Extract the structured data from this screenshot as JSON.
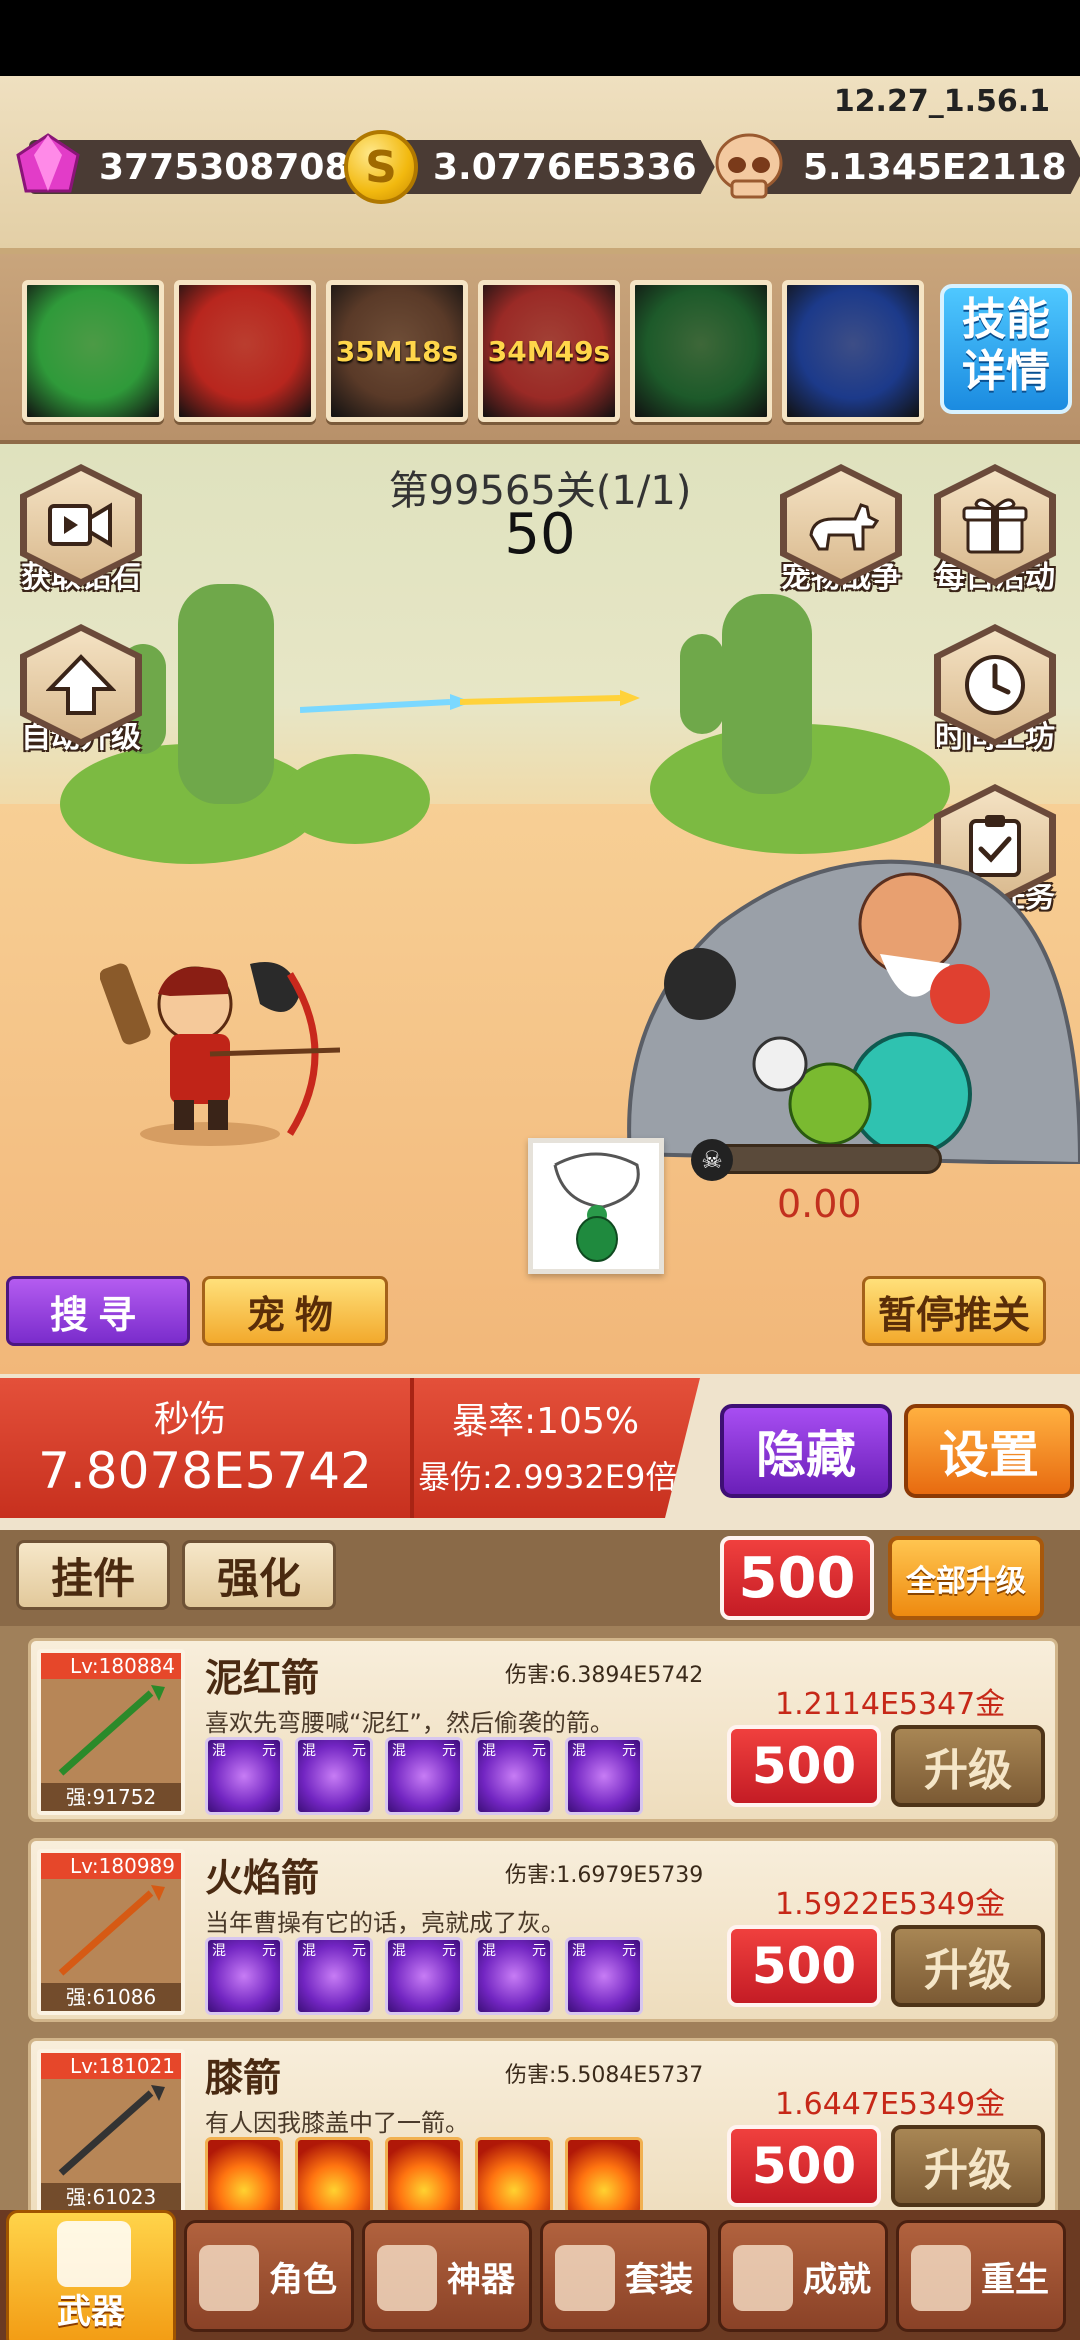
{
  "version": "12.27_1.56.1",
  "currencies": {
    "gems": "37753087084",
    "gold": "3.0776E5336",
    "souls": "5.1345E2118"
  },
  "coin_symbol": "S",
  "skills": [
    {
      "name": "green-arrows-skill-icon",
      "cooldown": "",
      "color": "#2f9a3a"
    },
    {
      "name": "red-slash-skill-icon",
      "cooldown": "",
      "color": "#b8261e"
    },
    {
      "name": "gold-burst-skill-icon",
      "cooldown": "35M18s",
      "color": "#5a3a28"
    },
    {
      "name": "red-aura-skill-icon",
      "cooldown": "34M49s",
      "color": "#9a2a26"
    },
    {
      "name": "bow-skill-icon",
      "cooldown": "",
      "color": "#1d5a2a"
    },
    {
      "name": "clock-skill-icon",
      "cooldown": "",
      "color": "#1c3a8a"
    }
  ],
  "skill_detail_label": "技能\n详情",
  "stage": {
    "label": "第99565关(1/1)",
    "count": "50"
  },
  "side_buttons": {
    "get_gems": "获取钻石",
    "auto_upgrade": "自动升级",
    "pet_war": "宠物战争",
    "daily_event": "每日活动",
    "time_workshop": "时间工坊",
    "daily_task": "日常任务"
  },
  "enemy_hp": "0.00",
  "enemy_hp_fraction": 0,
  "scene_buttons": {
    "search": "搜寻",
    "pet": "宠物",
    "pause": "暂停推关"
  },
  "dps": {
    "label": "秒伤",
    "value": "7.8078E5742",
    "crit_rate": "暴率:105%",
    "crit_damage": "暴伤:2.9932E9倍"
  },
  "buttons": {
    "hide": "隐藏",
    "settings": "设置"
  },
  "tabs": {
    "equip": "挂件",
    "enhance": "强化"
  },
  "bulk_qty": "500",
  "upgrade_all": "全部升级",
  "weapons": [
    {
      "level": "Lv:180884",
      "strength": "强:91752",
      "name": "泥红箭",
      "damage": "伤害:6.3894E5742",
      "desc": "喜欢先弯腰喊“泥红”，然后偷袭的箭。",
      "price": "1.2114E5347金",
      "qty": "500",
      "upgrade": "升级",
      "gem_type": "yinyang",
      "gem_tags": [
        "混",
        "元"
      ],
      "arrow_color": "#2b8a2a"
    },
    {
      "level": "Lv:180989",
      "strength": "强:61086",
      "name": "火焰箭",
      "damage": "伤害:1.6979E5739",
      "desc": "当年曹操有它的话，亮就成了灰。",
      "price": "1.5922E5349金",
      "qty": "500",
      "upgrade": "升级",
      "gem_type": "yinyang",
      "gem_tags": [
        "混",
        "元"
      ],
      "arrow_color": "#d65a14"
    },
    {
      "level": "Lv:181021",
      "strength": "强:61023",
      "name": "膝箭",
      "damage": "伤害:5.5084E5737",
      "desc": "有人因我膝盖中了一箭。",
      "price": "1.6447E5349金",
      "qty": "500",
      "upgrade": "升级",
      "gem_type": "fire",
      "gem_tags": [
        "",
        ""
      ],
      "arrow_color": "#333333"
    }
  ],
  "nav": [
    {
      "label": "武器",
      "icon": "crossed-swords-icon",
      "active": true
    },
    {
      "label": "角色",
      "icon": "helmet-icon",
      "active": false
    },
    {
      "label": "神器",
      "icon": "winged-emblem-icon",
      "active": false
    },
    {
      "label": "套装",
      "icon": "armor-set-icon",
      "active": false
    },
    {
      "label": "成就",
      "icon": "achievement-scroll-icon",
      "active": false
    },
    {
      "label": "重生",
      "icon": "rebirth-flame-icon",
      "active": false
    }
  ]
}
